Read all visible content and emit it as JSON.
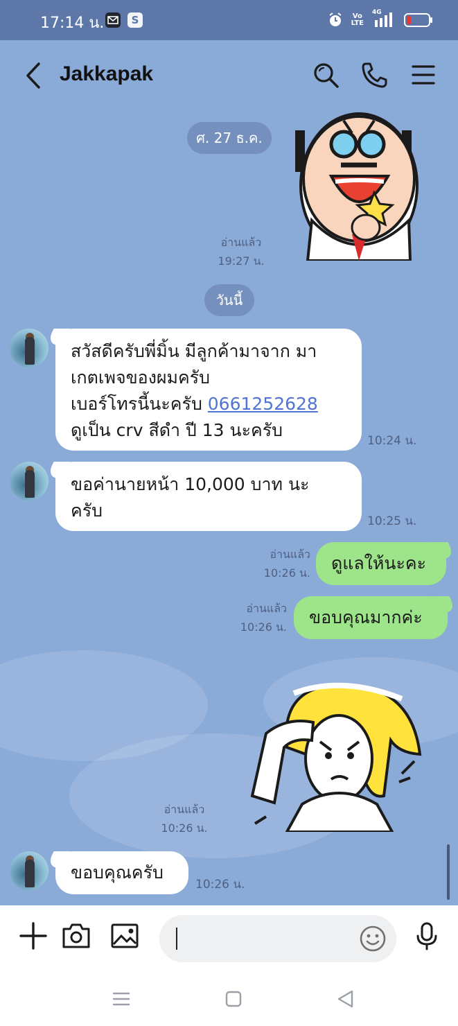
{
  "status_bar": {
    "time": "17:14 น.",
    "app_badge": "S",
    "network_volte_top": "Vo",
    "network_volte_bottom": "LTE",
    "network_type": "4G"
  },
  "header": {
    "title": "Jakkapak"
  },
  "chat": {
    "date_divider_1": "ศ. 27 ธ.ค.",
    "sticker1_read": "อ่านแล้ว",
    "sticker1_time": "19:27 น.",
    "date_divider_2": "วันนี้",
    "messages": [
      {
        "lines": [
          " สวัสดีครับพี่มิ้น  มีลูกค้ามาจาก มา",
          "เกตเพจของผมครับ",
          "เบอร์โทรนี้นะครับ ",
          "ดูเป็น crv สีดำ ปี 13 นะครับ"
        ],
        "phone": "0661252628",
        "time": "10:24 น."
      },
      {
        "lines": [
          "ขอค่านายหน้า 10,000 บาท นะ",
          "ครับ"
        ],
        "time": "10:25 น."
      },
      {
        "text": "ดูแลให้นะคะ",
        "read": "อ่านแล้ว",
        "time": "10:26 น."
      },
      {
        "text": "ขอบคุณมากค่ะ",
        "read": "อ่านแล้ว",
        "time": "10:26 น."
      },
      {
        "read": "อ่านแล้ว",
        "time": "10:26 น."
      },
      {
        "text": "ขอบคุณครับ",
        "time": "10:26 น."
      }
    ]
  },
  "input": {
    "placeholder": ""
  }
}
